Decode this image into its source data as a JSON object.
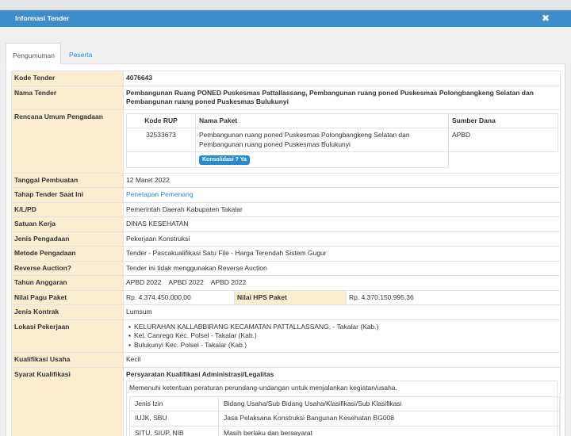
{
  "modal": {
    "title": "Informasi Tender"
  },
  "tabs": [
    {
      "label": "Pengumuman"
    },
    {
      "label": "Peserta"
    }
  ],
  "rows": {
    "kode_tender": {
      "label": "Kode Tender",
      "value": "4076643"
    },
    "nama_tender": {
      "label": "Nama Tender",
      "value": "Pembangunan Ruang PONED Puskesmas Pattallassang, Pembangunan ruang poned Puskesmas Polongbangkeng Selatan dan Pembangunan ruang poned Puskesmas Bulukunyi"
    },
    "rup": {
      "label": "Rencana Umum Pengadaan",
      "headers": [
        "Kode RUP",
        "Nama Paket",
        "Sumber Dana"
      ],
      "kode": "32533673",
      "nama": "Pembangunan ruang poned Puskesmas Polongbangkeng Selatan dan Pembangunan ruang poned Puskesmas Bulukunyi",
      "sumber": "APBD",
      "badge": "Konsolidasi ? Ya"
    },
    "tanggal": {
      "label": "Tanggal Pembuatan",
      "value": "12 Maret 2022"
    },
    "tahap": {
      "label": "Tahap Tender Saat Ini",
      "value": "Penetapan Pemenang"
    },
    "klpd": {
      "label": "K/L/PD",
      "value": "Pemerintah Daerah Kabupaten Takalar"
    },
    "satuan": {
      "label": "Satuan Kerja",
      "value": "DINAS KESEHATAN"
    },
    "jenis": {
      "label": "Jenis Pengadaan",
      "value": "Pekerjaan Konstruksi"
    },
    "metode": {
      "label": "Metode Pengadaan",
      "value": "Tender - Pascakualifikasi Satu File - Harga Terendah Sistem Gugur"
    },
    "reverse": {
      "label": "Reverse Auction?",
      "value": "Tender ini tidak menggunakan Reverse Auction"
    },
    "tahun": {
      "label": "Tahun Anggaran",
      "value": "APBD 2022    APBD 2022    APBD 2022"
    },
    "pagu": {
      "label": "Nilai Pagu Paket",
      "value": "Rp. 4.374.450.000,00",
      "hps_label": "Nilai HPS Paket",
      "hps_value": "Rp. 4.370.150.995,36"
    },
    "kontrak": {
      "label": "Jenis Kontrak",
      "value": "Lumsum"
    },
    "lokasi": {
      "label": "Lokasi Pekerjaan",
      "items": [
        "KELURAHAN KALLABBIRANG KECAMATAN PATTALLASSANG, - Takalar (Kab.)",
        "Kel. Canrego Kec. Polsel - Takalar (Kab.)",
        "Bulukunyi Kec. Polsel - Takalar (Kab.)"
      ]
    },
    "kualifikasi": {
      "label": "Kualifikasi Usaha",
      "value": "Kecil"
    },
    "syarat": {
      "label": "Syarat Kualifikasi",
      "heading": "Persyaratan Kualifikasi Administrasi/Legalitas",
      "note": "Memenuhi ketentuan peraturan perundang-undangan untuk menjalankan kegiatan/usaha.",
      "items": [
        {
          "k": "Jenis Izin",
          "v": "Bidang Usaha/Sub Bidang Usaha/Klasifikasi/Sub Klasifikasi"
        },
        {
          "k": "IUJK, SBU",
          "v": "Jasa Pelaksana Konstruksi Bangunan Kesehatan BG008"
        },
        {
          "k": "SITU, SIUP, NIB",
          "v": "Masih berlaku dan bersayarat"
        }
      ]
    }
  }
}
